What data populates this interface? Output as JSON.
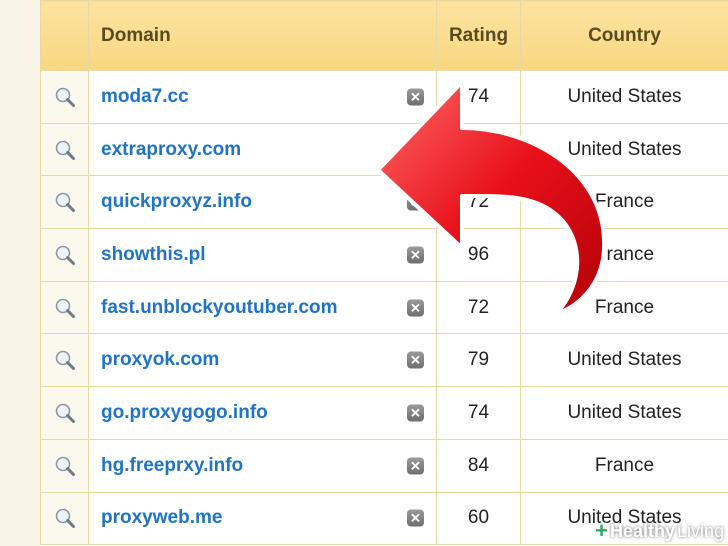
{
  "table": {
    "headers": {
      "domain": "Domain",
      "rating": "Rating",
      "country": "Country"
    },
    "rows": [
      {
        "domain": "moda7.cc",
        "rating": "74",
        "country": "United States"
      },
      {
        "domain": "extraproxy.com",
        "rating": "",
        "country": "United States"
      },
      {
        "domain": "quickproxyz.info",
        "rating": "72",
        "country": "France"
      },
      {
        "domain": "showthis.pl",
        "rating": "96",
        "country": "France"
      },
      {
        "domain": "fast.unblockyoutuber.com",
        "rating": "72",
        "country": "France"
      },
      {
        "domain": "proxyok.com",
        "rating": "79",
        "country": "United States"
      },
      {
        "domain": "go.proxygogo.info",
        "rating": "74",
        "country": "United States"
      },
      {
        "domain": "hg.freeprxy.info",
        "rating": "84",
        "country": "France"
      },
      {
        "domain": "proxyweb.me",
        "rating": "60",
        "country": "United States"
      }
    ],
    "remove_glyph": "✕"
  },
  "watermark": {
    "plus": "+",
    "bold": "Healthy",
    "light": " Living"
  },
  "colors": {
    "header_bg": "#f7d780",
    "link": "#1f74c9",
    "arrow": "#e8101a"
  },
  "icons": {
    "row_icon": "search-icon",
    "remove_icon": "close-icon",
    "overlay": "curved-arrow-left"
  }
}
